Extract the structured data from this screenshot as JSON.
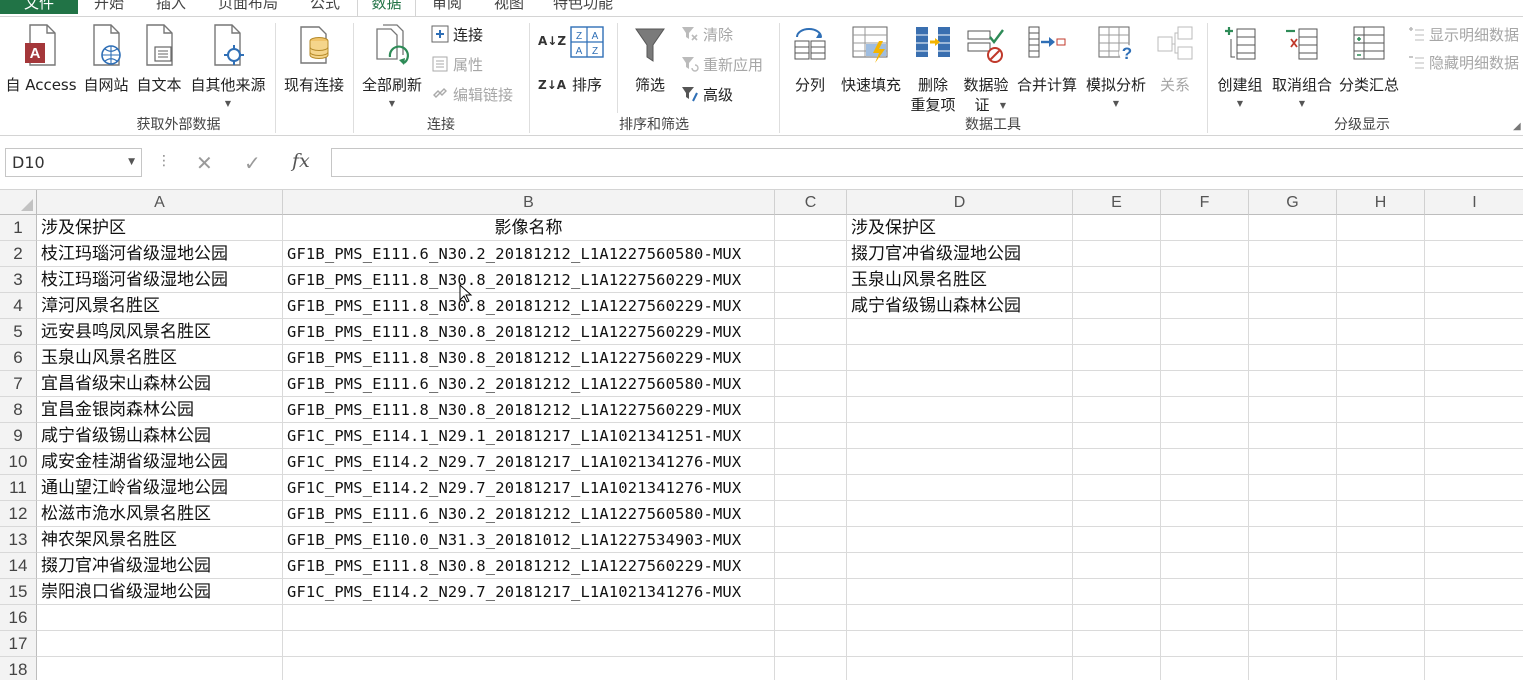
{
  "tabs": {
    "file": "文件",
    "home": "开始",
    "insert": "插入",
    "layout": "页面布局",
    "formulas": "公式",
    "data": "数据",
    "review": "审阅",
    "view": "视图",
    "special": "特色功能"
  },
  "ribbon": {
    "external": {
      "access": "自 Access",
      "web": "自网站",
      "text": "自文本",
      "other": "自其他来源",
      "existing": "现有连接",
      "group_label": "获取外部数据"
    },
    "connections": {
      "refresh_all": "全部刷新",
      "connections": "连接",
      "properties": "属性",
      "edit_links": "编辑链接",
      "group_label": "连接"
    },
    "sort_filter": {
      "sort": "排序",
      "filter": "筛选",
      "clear": "清除",
      "reapply": "重新应用",
      "advanced": "高级",
      "group_label": "排序和筛选",
      "sort_az": "A↓Z",
      "sort_za": "Z↓A"
    },
    "data_tools": {
      "text_to_columns": "分列",
      "flash_fill": "快速填充",
      "remove_dup_1": "删除",
      "remove_dup_2": "重复项",
      "validation_1": "数据验",
      "validation_2": "证",
      "consolidate": "合并计算",
      "what_if": "模拟分析",
      "relationships": "关系",
      "group_label": "数据工具"
    },
    "outline": {
      "group": "创建组",
      "ungroup": "取消组合",
      "subtotal": "分类汇总",
      "show_detail": "显示明细数据",
      "hide_detail": "隐藏明细数据",
      "group_label": "分级显示"
    }
  },
  "formula_bar": {
    "name_box": "D10",
    "formula": "",
    "fx": "fx"
  },
  "sheet": {
    "columns": [
      "A",
      "B",
      "C",
      "D",
      "E",
      "F",
      "G",
      "H",
      "I"
    ],
    "rows": [
      {
        "n": "1",
        "a": "涉及保护区",
        "b": "影像名称",
        "d": "涉及保护区"
      },
      {
        "n": "2",
        "a": "枝江玛瑙河省级湿地公园",
        "b": "GF1B_PMS_E111.6_N30.2_20181212_L1A1227560580-MUX",
        "d": "掇刀官冲省级湿地公园"
      },
      {
        "n": "3",
        "a": "枝江玛瑙河省级湿地公园",
        "b": "GF1B_PMS_E111.8_N30.8_20181212_L1A1227560229-MUX",
        "d": "玉泉山风景名胜区"
      },
      {
        "n": "4",
        "a": "漳河风景名胜区",
        "b": "GF1B_PMS_E111.8_N30.8_20181212_L1A1227560229-MUX",
        "d": "咸宁省级锡山森林公园"
      },
      {
        "n": "5",
        "a": "远安县鸣凤风景名胜区",
        "b": "GF1B_PMS_E111.8_N30.8_20181212_L1A1227560229-MUX",
        "d": ""
      },
      {
        "n": "6",
        "a": "玉泉山风景名胜区",
        "b": "GF1B_PMS_E111.8_N30.8_20181212_L1A1227560229-MUX",
        "d": ""
      },
      {
        "n": "7",
        "a": "宜昌省级宋山森林公园",
        "b": "GF1B_PMS_E111.6_N30.2_20181212_L1A1227560580-MUX",
        "d": ""
      },
      {
        "n": "8",
        "a": "宜昌金银岗森林公园",
        "b": "GF1B_PMS_E111.8_N30.8_20181212_L1A1227560229-MUX",
        "d": ""
      },
      {
        "n": "9",
        "a": "咸宁省级锡山森林公园",
        "b": "GF1C_PMS_E114.1_N29.1_20181217_L1A1021341251-MUX",
        "d": ""
      },
      {
        "n": "10",
        "a": "咸安金桂湖省级湿地公园",
        "b": "GF1C_PMS_E114.2_N29.7_20181217_L1A1021341276-MUX",
        "d": ""
      },
      {
        "n": "11",
        "a": "通山望江岭省级湿地公园",
        "b": "GF1C_PMS_E114.2_N29.7_20181217_L1A1021341276-MUX",
        "d": ""
      },
      {
        "n": "12",
        "a": "松滋市洈水风景名胜区",
        "b": "GF1B_PMS_E111.6_N30.2_20181212_L1A1227560580-MUX",
        "d": ""
      },
      {
        "n": "13",
        "a": "神农架风景名胜区",
        "b": "GF1B_PMS_E110.0_N31.3_20181012_L1A1227534903-MUX",
        "d": ""
      },
      {
        "n": "14",
        "a": "掇刀官冲省级湿地公园",
        "b": "GF1B_PMS_E111.8_N30.8_20181212_L1A1227560229-MUX",
        "d": ""
      },
      {
        "n": "15",
        "a": "崇阳浪口省级湿地公园",
        "b": "GF1C_PMS_E114.2_N29.7_20181217_L1A1021341276-MUX",
        "d": ""
      },
      {
        "n": "16",
        "a": "",
        "b": "",
        "d": ""
      },
      {
        "n": "17",
        "a": "",
        "b": "",
        "d": ""
      },
      {
        "n": "18",
        "a": "",
        "b": "",
        "d": ""
      }
    ]
  },
  "colors": {
    "accent": "#217346",
    "grid": "#dadada",
    "header_bg": "#f3f3f3"
  }
}
